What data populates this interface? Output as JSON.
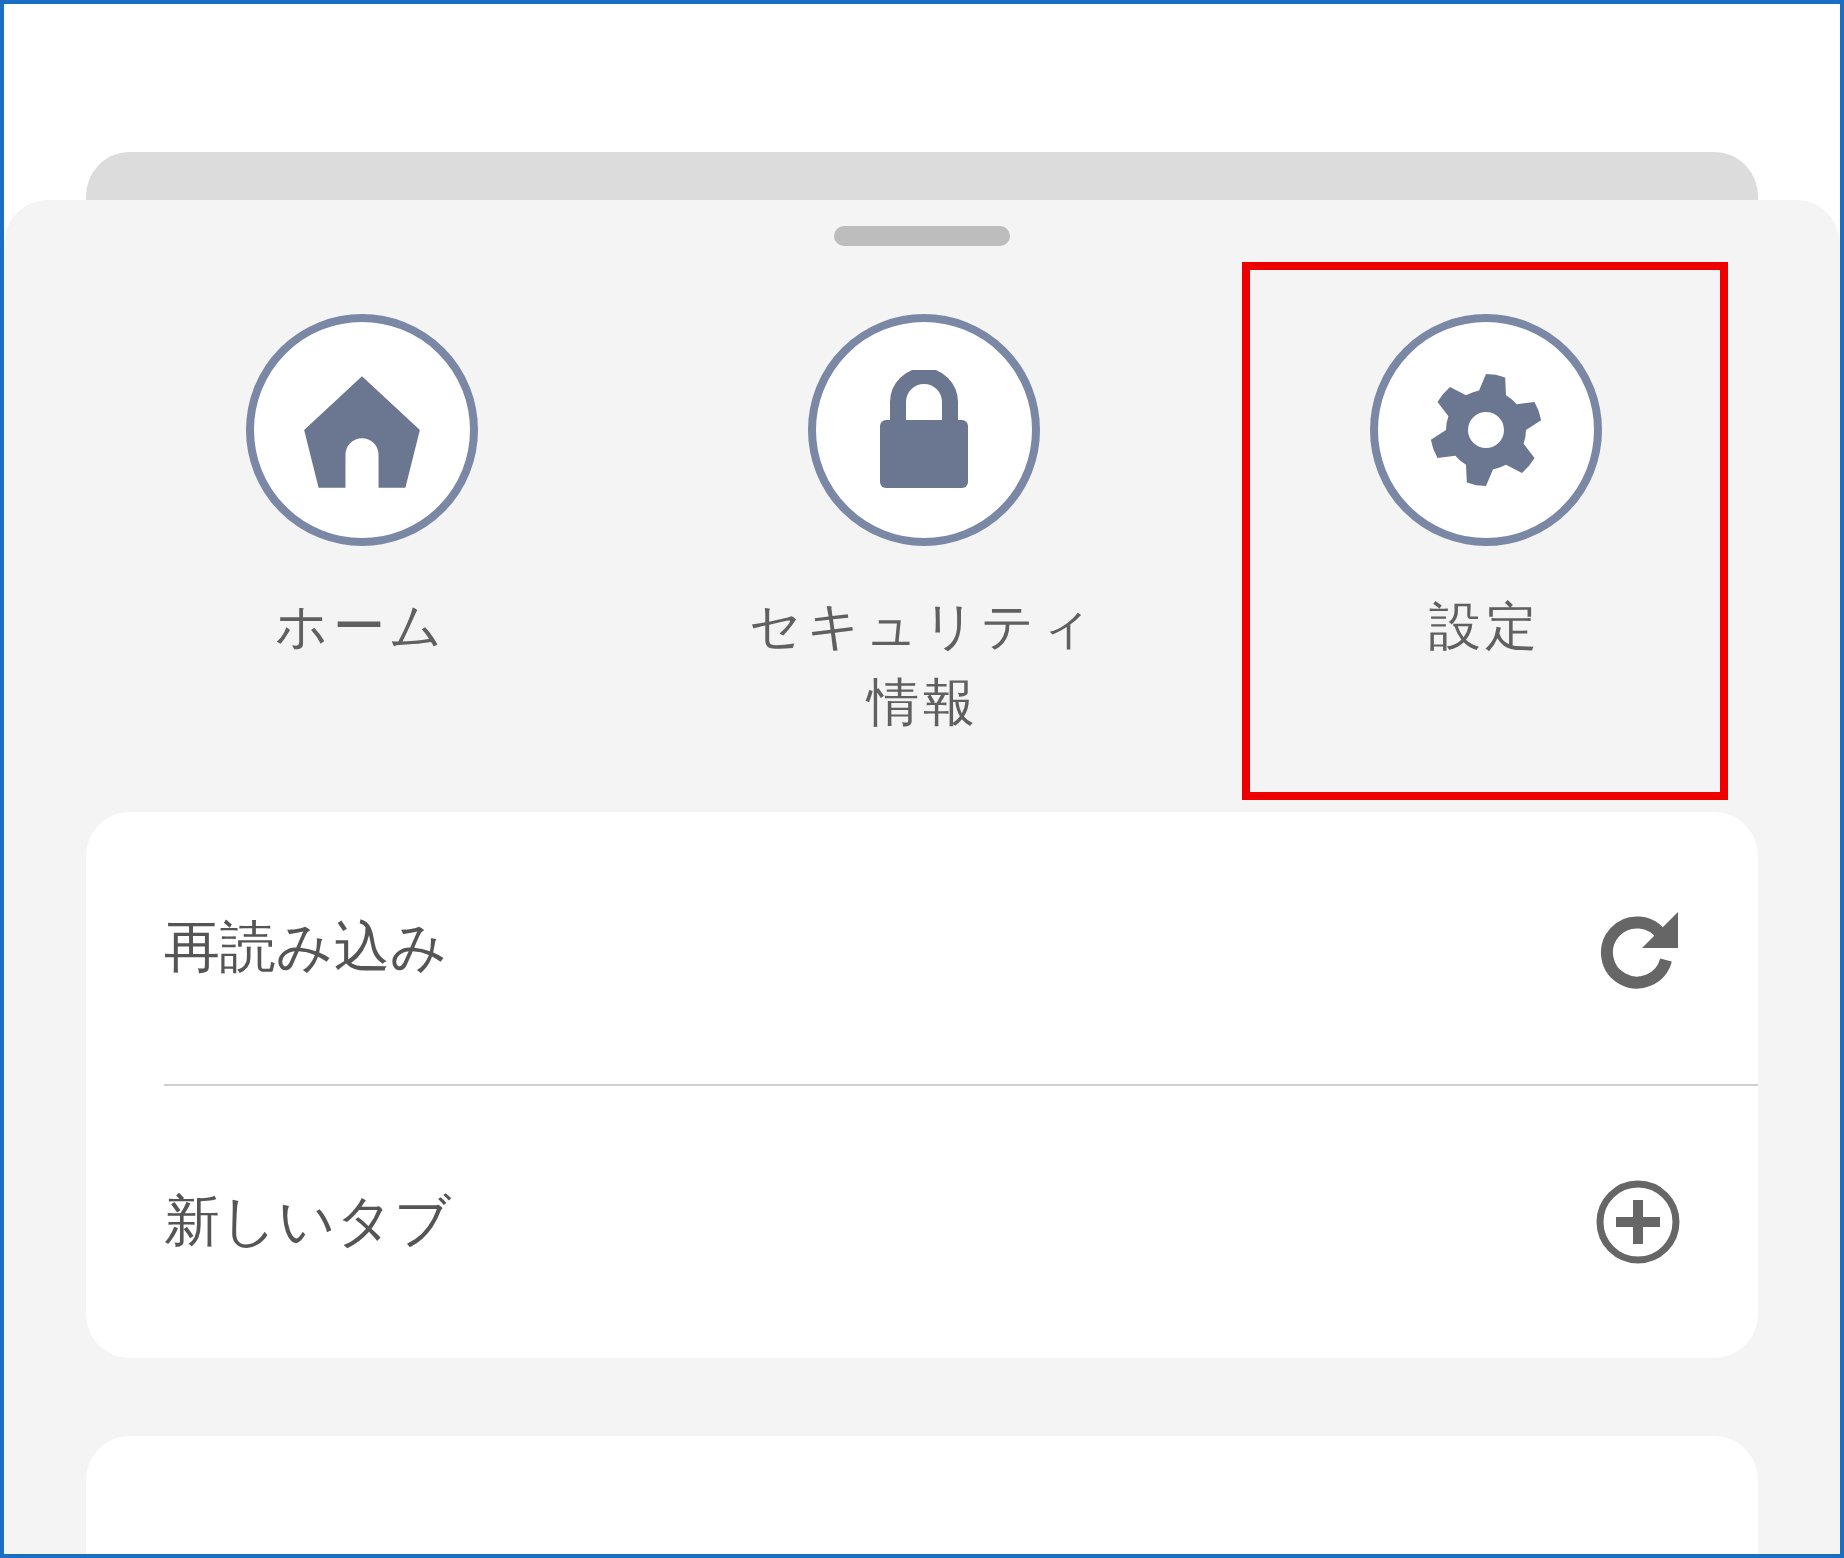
{
  "shortcuts": [
    {
      "label_lines": [
        "ホーム"
      ],
      "kind": "home",
      "highlighted": false
    },
    {
      "label_lines": [
        "セキュリティ",
        "情報"
      ],
      "kind": "lock",
      "highlighted": false
    },
    {
      "label_lines": [
        "設定"
      ],
      "kind": "gear",
      "highlighted": true
    }
  ],
  "menu": [
    {
      "label": "再読み込み",
      "kind": "reload"
    },
    {
      "label": "新しいタブ",
      "kind": "plus"
    }
  ]
}
